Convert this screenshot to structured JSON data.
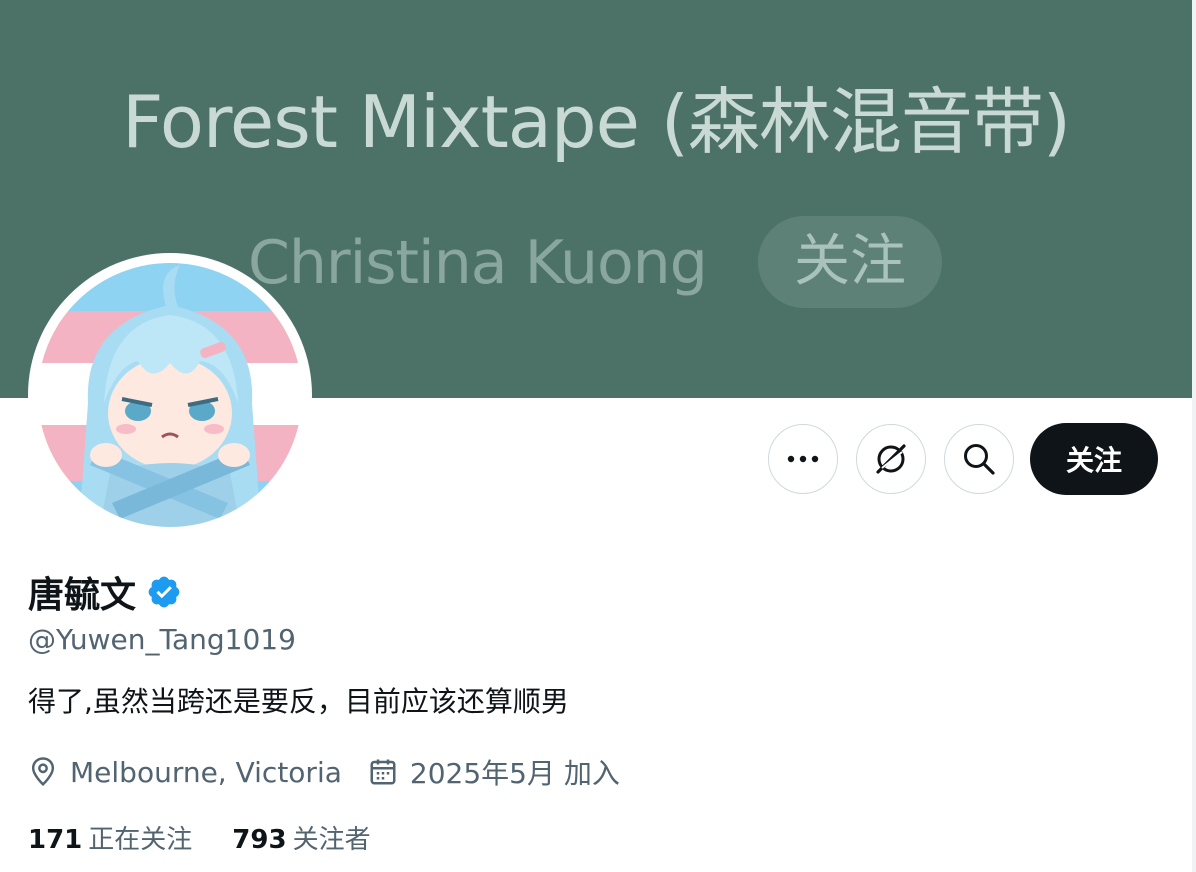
{
  "banner": {
    "title": "Forest Mixtape (森林混音带)",
    "artist": "Christina Kuong",
    "follow_label": "关注",
    "background_color": "#4c7268"
  },
  "avatar": {
    "icon": "anime-girl-avatar",
    "flag_colors": [
      "#5bcefa",
      "#f5a9b8",
      "#ffffff"
    ]
  },
  "actions": {
    "more_icon": "more-horizontal-icon",
    "grok_icon": "grok-icon",
    "search_icon": "search-icon",
    "follow_label": "关注"
  },
  "profile": {
    "display_name": "唐毓文",
    "verified": true,
    "handle": "@Yuwen_Tang1019",
    "bio": "得了,虽然当跨还是要反，目前应该还算顺男",
    "location": "Melbourne, Victoria",
    "joined": "2025年5月 加入"
  },
  "stats": {
    "following_count": "171",
    "following_label": "正在关注",
    "followers_count": "793",
    "followers_label": "关注者"
  },
  "colors": {
    "accent": "#0f1419",
    "secondary_text": "#536471",
    "verified": "#1d9bf0"
  }
}
